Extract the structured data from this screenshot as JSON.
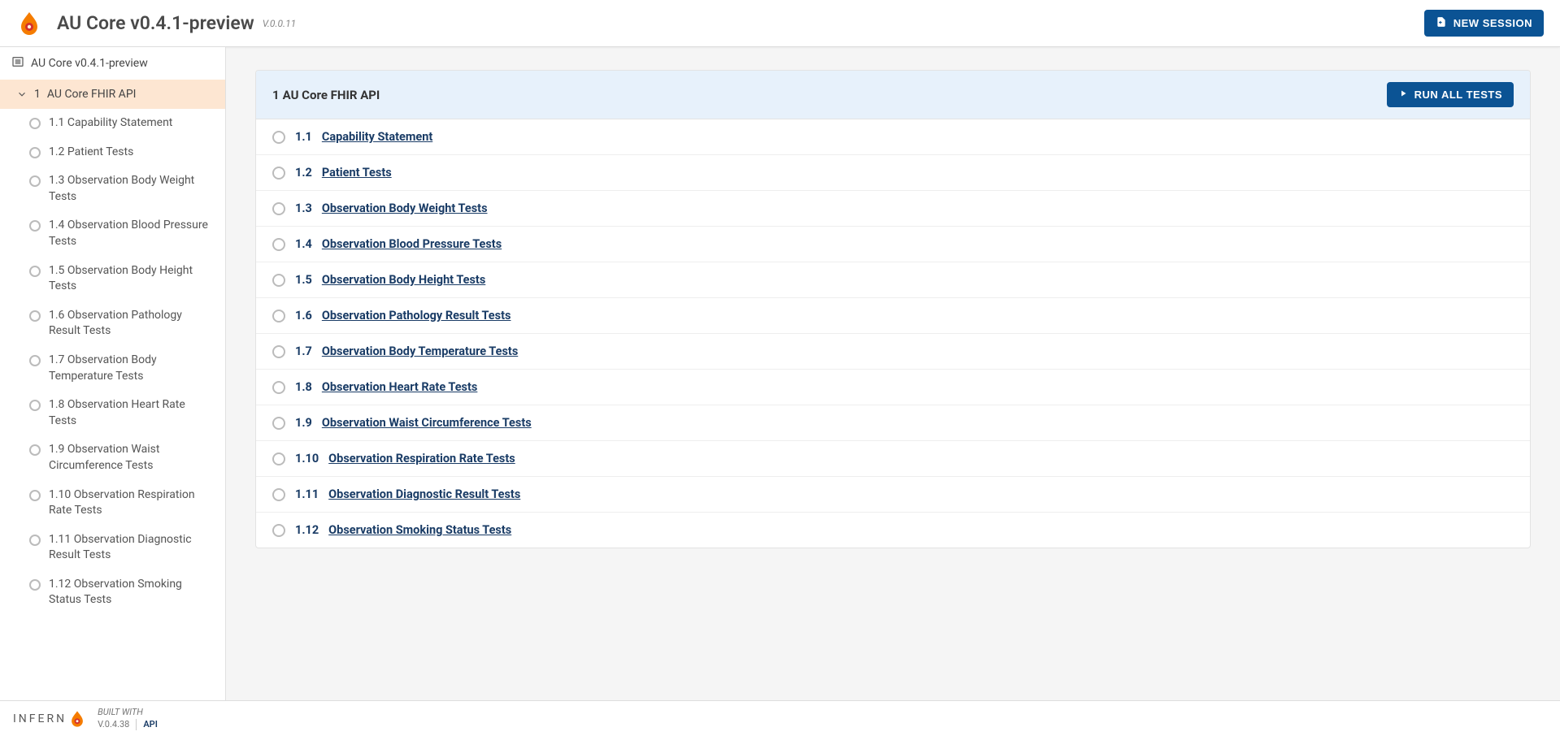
{
  "header": {
    "title": "AU Core v0.4.1-preview",
    "version": "V.0.0.11",
    "new_session": "NEW SESSION"
  },
  "sidebar": {
    "root": "AU Core v0.4.1-preview",
    "group_num": "1",
    "group_label": "AU Core FHIR API",
    "items": [
      {
        "num": "1.1",
        "label": "Capability Statement"
      },
      {
        "num": "1.2",
        "label": "Patient Tests"
      },
      {
        "num": "1.3",
        "label": "Observation Body Weight Tests"
      },
      {
        "num": "1.4",
        "label": "Observation Blood Pressure Tests"
      },
      {
        "num": "1.5",
        "label": "Observation Body Height Tests"
      },
      {
        "num": "1.6",
        "label": "Observation Pathology Result Tests"
      },
      {
        "num": "1.7",
        "label": "Observation Body Temperature Tests"
      },
      {
        "num": "1.8",
        "label": "Observation Heart Rate Tests"
      },
      {
        "num": "1.9",
        "label": "Observation Waist Circumference Tests"
      },
      {
        "num": "1.10",
        "label": "Observation Respiration Rate Tests"
      },
      {
        "num": "1.11",
        "label": "Observation Diagnostic Result Tests"
      },
      {
        "num": "1.12",
        "label": "Observation Smoking Status Tests"
      }
    ]
  },
  "main": {
    "group_num": "1",
    "group_title": "AU Core FHIR API",
    "run_label": "RUN ALL TESTS",
    "tests": [
      {
        "num": "1.1",
        "label": "Capability Statement"
      },
      {
        "num": "1.2",
        "label": "Patient Tests"
      },
      {
        "num": "1.3",
        "label": "Observation Body Weight Tests"
      },
      {
        "num": "1.4",
        "label": "Observation Blood Pressure Tests"
      },
      {
        "num": "1.5",
        "label": "Observation Body Height Tests"
      },
      {
        "num": "1.6",
        "label": "Observation Pathology Result Tests"
      },
      {
        "num": "1.7",
        "label": "Observation Body Temperature Tests"
      },
      {
        "num": "1.8",
        "label": "Observation Heart Rate Tests"
      },
      {
        "num": "1.9",
        "label": "Observation Waist Circumference Tests"
      },
      {
        "num": "1.10",
        "label": "Observation Respiration Rate Tests"
      },
      {
        "num": "1.11",
        "label": "Observation Diagnostic Result Tests"
      },
      {
        "num": "1.12",
        "label": "Observation Smoking Status Tests"
      }
    ]
  },
  "footer": {
    "brand_left": "INFERN",
    "built_with": "BUILT WITH",
    "version": "V.0.4.38",
    "api": "API"
  }
}
